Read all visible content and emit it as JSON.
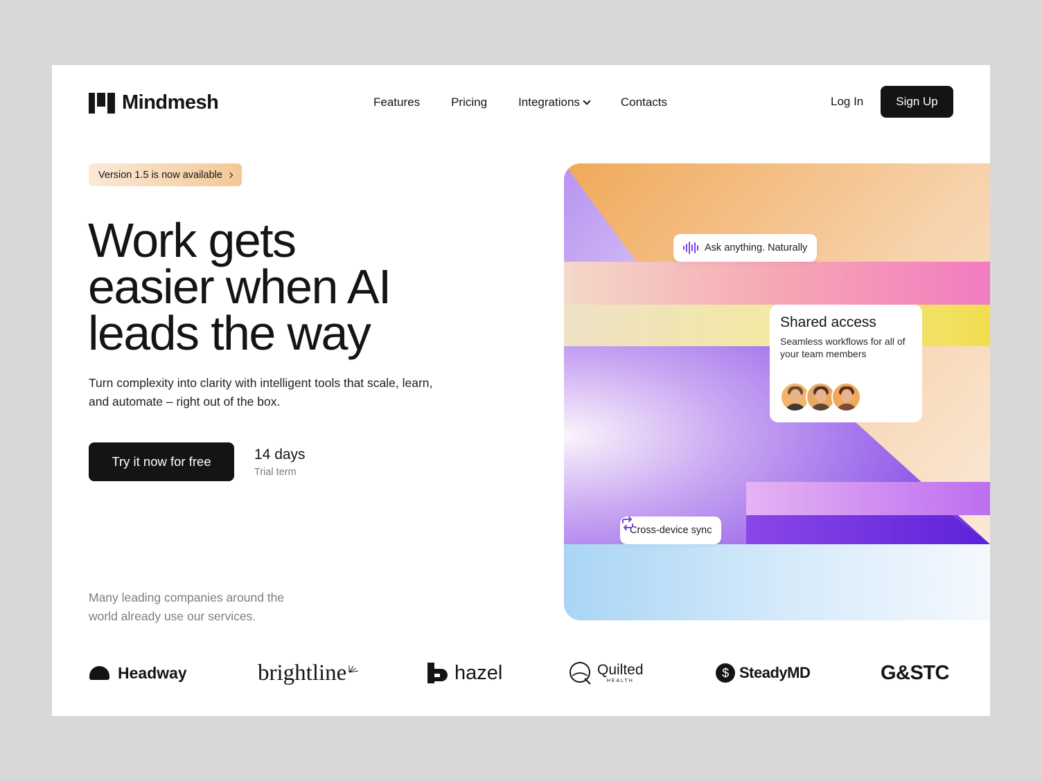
{
  "brand": {
    "name": "Mindmesh"
  },
  "nav": {
    "items": [
      {
        "label": "Features"
      },
      {
        "label": "Pricing"
      },
      {
        "label": "Integrations",
        "icon": "chevron-down-icon"
      },
      {
        "label": "Contacts"
      }
    ],
    "login_label": "Log In",
    "signup_label": "Sign Up"
  },
  "hero": {
    "badge": "Version 1.5 is now available",
    "headline_lines": [
      "Work gets",
      "easier when AI",
      "leads the way"
    ],
    "subtext": "Turn complexity into clarity with intelligent tools that scale, learn, and automate – right out of the box.",
    "cta_label": "Try it now for free",
    "trial_days": "14 days",
    "trial_term": "Trial term"
  },
  "visual": {
    "ask_chip": "Ask anything. Naturally",
    "sync_chip": "Cross-device sync",
    "card": {
      "title": "Shared access",
      "description": "Seamless workflows for all of your team members"
    },
    "accent_color": "#7b3fe4"
  },
  "companies": {
    "note": "Many leading companies around the world already use our services.",
    "logos": [
      "Headway",
      "brightline",
      "hazel",
      "Quilted",
      "HEALTH",
      "SteadyMD",
      "G&STC"
    ]
  }
}
